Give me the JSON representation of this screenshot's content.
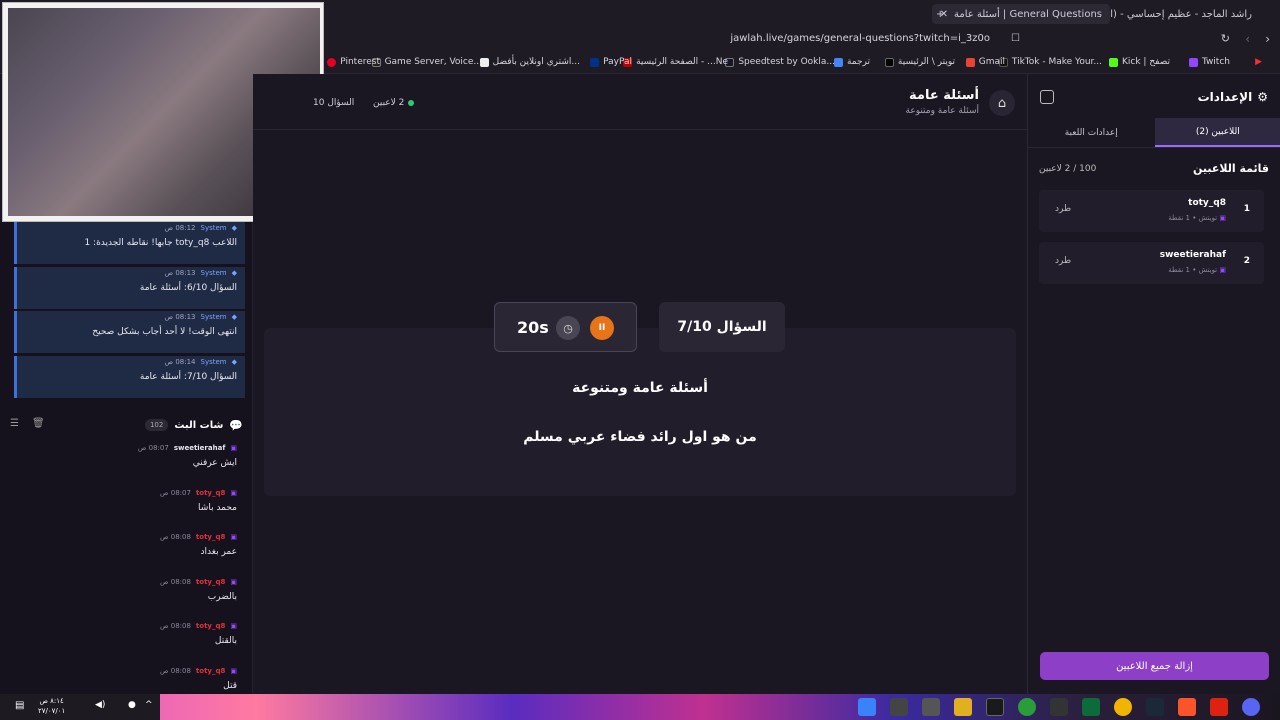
{
  "browser": {
    "tabs": [
      {
        "label": "General Questions | أسئلة عامة"
      },
      {
        "label": "راشد الماجد - عظيم إحساسي - (الن..."
      }
    ],
    "url": "jawlah.live/games/general-questions?twitch=i_3z0o",
    "bookmarks": [
      "Twitch",
      "Kick | تصفح",
      "TikTok - Make Your...",
      "Gmail",
      "تويتر \\ الرئيسية",
      "ترجمة",
      "Speedtest by Ookla...",
      "الصفحة الرئيسية - ...Ne",
      "PayPal",
      "اشتري اونلاين بأفضل...",
      "Game Server, Voice...",
      "Pinterest"
    ]
  },
  "system_messages": [
    {
      "name": "System",
      "time": "08:12 ص",
      "text": "اللاعب toty_q8 جابها! نقاطه الجديدة: 1"
    },
    {
      "name": "System",
      "time": "08:13 ص",
      "text": "السؤال 6/10: أسئلة عامة"
    },
    {
      "name": "System",
      "time": "08:13 ص",
      "text": "انتهى الوقت! لا أحد أجاب بشكل صحيح"
    },
    {
      "name": "System",
      "time": "08:14 ص",
      "text": "السؤال 7/10: أسئلة عامة"
    }
  ],
  "chat": {
    "title": "شات البث",
    "count": "102",
    "messages": [
      {
        "name": "sweetierahaf",
        "time": "08:07 ص",
        "text": "ايش عرفني",
        "red": false
      },
      {
        "name": "toty_q8",
        "time": "08:07 ص",
        "text": "محمد باشا",
        "red": true
      },
      {
        "name": "toty_q8",
        "time": "08:08 ص",
        "text": "عمر بغداد",
        "red": true
      },
      {
        "name": "toty_q8",
        "time": "08:08 ص",
        "text": "بالضرب",
        "red": true
      },
      {
        "name": "toty_q8",
        "time": "08:08 ص",
        "text": "بالقتل",
        "red": true
      },
      {
        "name": "toty_q8",
        "time": "08:08 ص",
        "text": "قتل",
        "red": true
      }
    ]
  },
  "game": {
    "title": "أسئلة عامة",
    "subtitle": "أسئلة عامة ومتنوعة",
    "players_online": "2 لاعبين",
    "question_top": "السؤال 10",
    "question_counter": "السؤال 7/10",
    "timer": "20s",
    "category": "أسئلة عامة ومتنوعة",
    "question": "من هو اول رائد فضاء عربي مسلم"
  },
  "settings": {
    "title": "الإعدادات",
    "tabs": [
      {
        "label": "اللاعبين (2)",
        "active": true
      },
      {
        "label": "إعدادات اللعبة",
        "active": false
      }
    ],
    "players_title": "قائمة اللاعبين",
    "players_count": "100 / 2 لاعبين",
    "players": [
      {
        "rank": "1",
        "name": "toty_q8",
        "platform": "تويتش",
        "points": "1 نقطة",
        "kick": "طرد"
      },
      {
        "rank": "2",
        "name": "sweetierahaf",
        "platform": "تويتش",
        "points": "1 نقطة",
        "kick": "طرد"
      }
    ],
    "remove_all": "إزالة جميع اللاعبين"
  },
  "taskbar": {
    "time": "٨:١٤ ص",
    "date": "٢٧/٠٧/٠١"
  },
  "colors": {
    "accent": "#8d3fc8",
    "timer_pause": "#e8741a",
    "online": "#2ecc71",
    "system_border": "#3f6fd8"
  }
}
